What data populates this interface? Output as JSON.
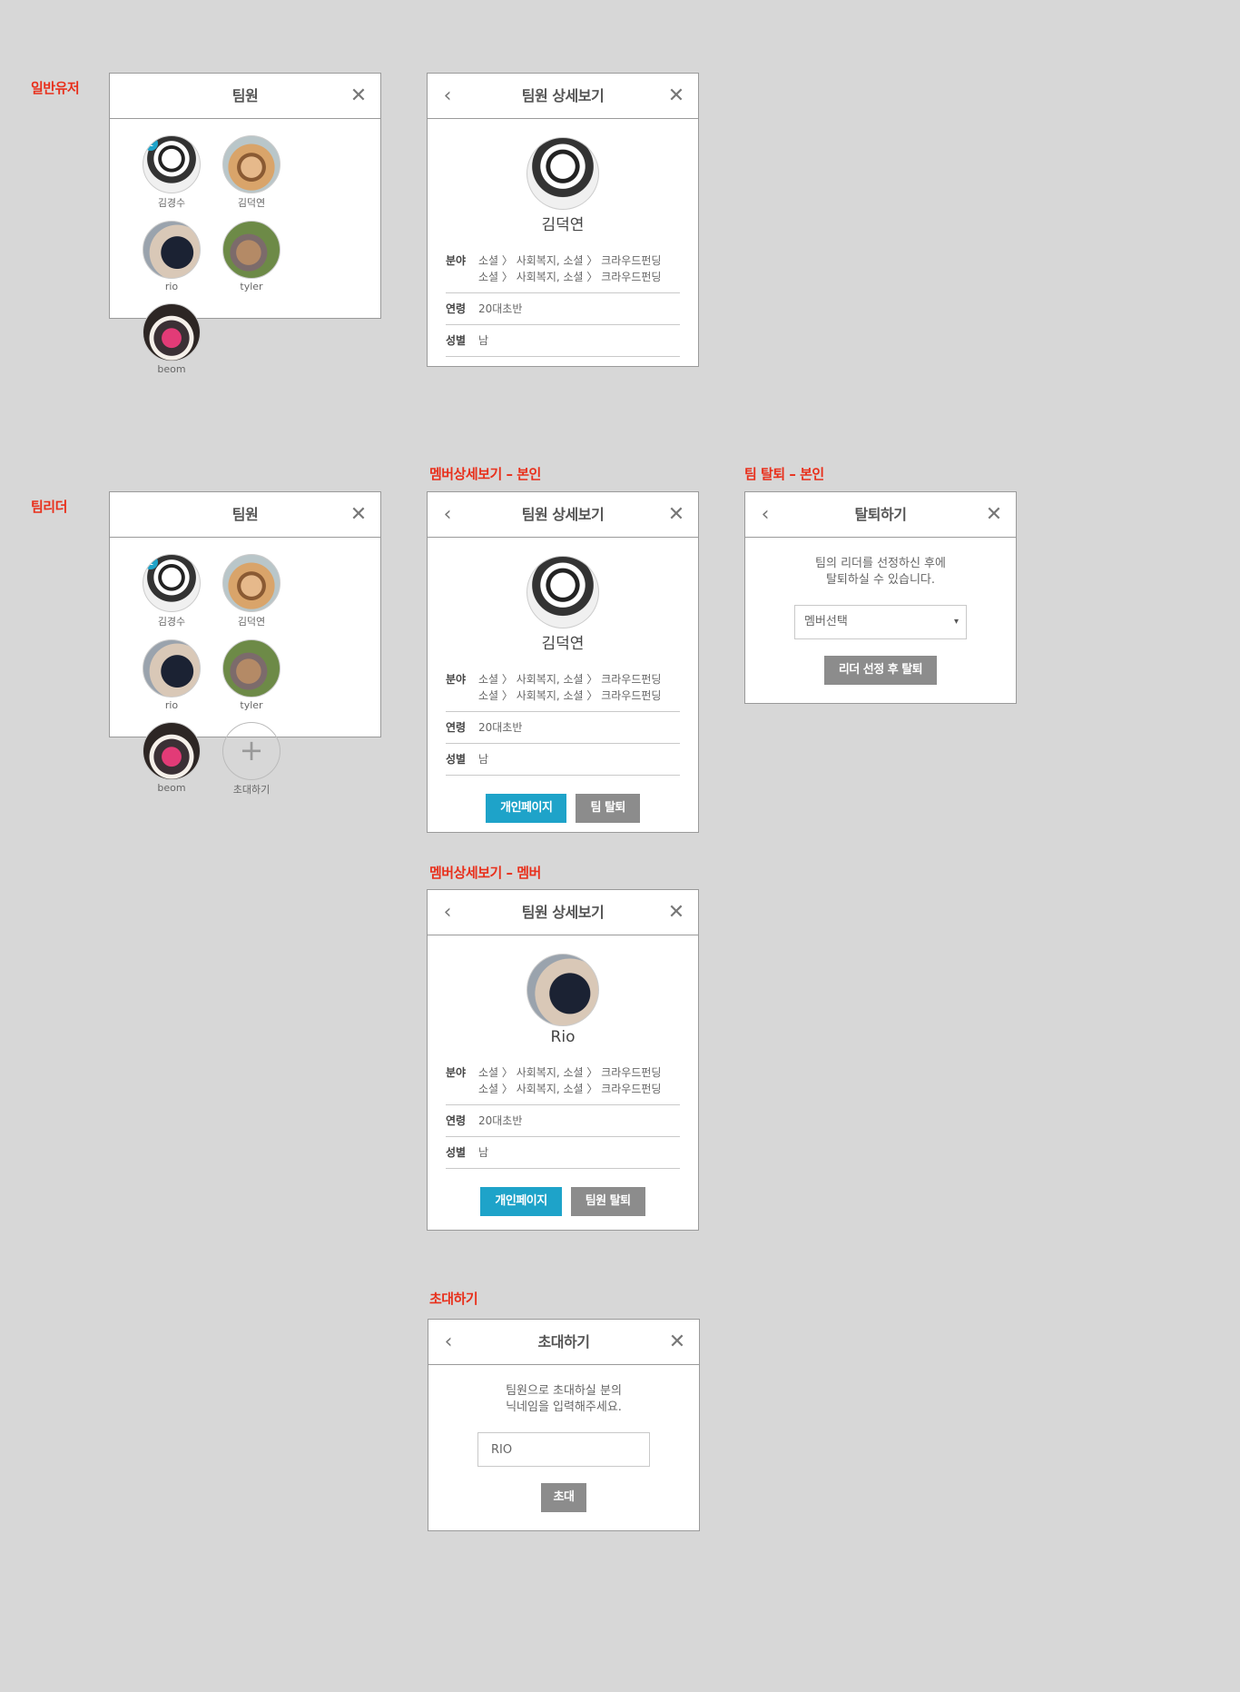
{
  "labels": {
    "general_user": "일반유저",
    "team_leader": "팀리더",
    "member_detail_self": "멤버상세보기 – 본인",
    "team_leave_self": "팀 탈퇴 – 본인",
    "member_detail_member": "멤버상세보기 – 멤버",
    "invite": "초대하기"
  },
  "member_panel": {
    "title": "팀원",
    "members": [
      {
        "name": "김경수",
        "badge": "1"
      },
      {
        "name": "김덕연"
      },
      {
        "name": "rio"
      },
      {
        "name": "tyler"
      },
      {
        "name": "beom"
      }
    ],
    "invite_label": "초대하기",
    "invite_icon": "+"
  },
  "detail_kim": {
    "title": "팀원 상세보기",
    "name": "김덕연",
    "field_key": "분야",
    "field_value_1": "소셜 〉 사회복지, 소셜 〉 크라우드펀딩",
    "field_value_2": "소셜 〉 사회복지, 소셜 〉 크라우드펀딩",
    "age_key": "연령",
    "age_value": "20대초반",
    "gender_key": "성별",
    "gender_value": "남"
  },
  "detail_self_buttons": {
    "personal_page": "개인페이지",
    "leave_team": "팀 탈퇴"
  },
  "detail_rio": {
    "title": "팀원 상세보기",
    "name": "Rio",
    "field_key": "분야",
    "field_value_1": "소셜 〉 사회복지, 소셜 〉 크라우드펀딩",
    "field_value_2": "소셜 〉 사회복지, 소셜 〉 크라우드펀딩",
    "age_key": "연령",
    "age_value": "20대초반",
    "gender_key": "성별",
    "gender_value": "남",
    "personal_page": "개인페이지",
    "kick_member": "팀원 탈퇴"
  },
  "leave_panel": {
    "title": "탈퇴하기",
    "message_1": "팀의 리더를 선정하신 후에",
    "message_2": "탈퇴하실 수 있습니다.",
    "select_value": "멤버선택",
    "button": "리더 선정 후 탈퇴"
  },
  "invite_panel": {
    "title": "초대하기",
    "message_1": "팀원으로 초대하실 분의",
    "message_2": "닉네임을 입력해주세요.",
    "input_value": "RIO",
    "button": "초대"
  },
  "icons": {
    "close": "✕",
    "back": "‹",
    "caret": "▾"
  },
  "colors": {
    "background": "#d7d7d7",
    "label_red": "#e8301c",
    "accent_blue": "#1ea3c9",
    "button_gray": "#8c8c8c"
  }
}
